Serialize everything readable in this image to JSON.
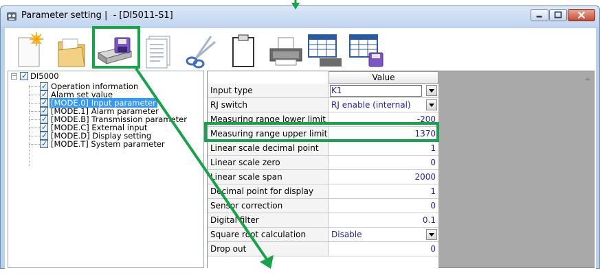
{
  "window": {
    "title": "Parameter setting |  - [DI5011-S1]"
  },
  "toolbar": {
    "tools": [
      {
        "name": "new-file-icon"
      },
      {
        "name": "open-folder-icon"
      },
      {
        "name": "save-to-device-icon"
      },
      {
        "name": "document-icon"
      },
      {
        "name": "scissors-icon"
      },
      {
        "name": "clipboard-icon"
      },
      {
        "name": "printer-icon"
      },
      {
        "name": "print-table-icon"
      },
      {
        "name": "save-table-icon"
      }
    ]
  },
  "tree": {
    "root": "DI5000",
    "items": [
      {
        "label": "Operation information",
        "selected": false
      },
      {
        "label": "Alarm set value",
        "selected": false
      },
      {
        "label": "[MODE.0] Input parameter",
        "selected": true
      },
      {
        "label": "[MODE.1] Alarm parameter",
        "selected": false
      },
      {
        "label": "[MODE.B] Transmission parameter",
        "selected": false
      },
      {
        "label": "[MODE.C] External input",
        "selected": false
      },
      {
        "label": "[MODE.D] Display setting",
        "selected": false
      },
      {
        "label": "[MODE.T] System parameter",
        "selected": false
      }
    ]
  },
  "grid": {
    "header": "Value",
    "rows": [
      {
        "name": "Input type",
        "value": "K1",
        "combo": true
      },
      {
        "name": "RJ switch",
        "value": "RJ enable (internal)",
        "combo": true
      },
      {
        "name": "Measuring range lower limit",
        "value": "-200",
        "combo": false
      },
      {
        "name": "Measuring range upper limit",
        "value": "1370",
        "combo": false
      },
      {
        "name": "Linear scale decimal point",
        "value": "1",
        "combo": false
      },
      {
        "name": "Linear scale zero",
        "value": "0",
        "combo": false
      },
      {
        "name": "Linear scale span",
        "value": "2000",
        "combo": false
      },
      {
        "name": "Decimal point for display",
        "value": "1",
        "combo": false
      },
      {
        "name": "Sensor correction",
        "value": "0",
        "combo": false
      },
      {
        "name": "Digital filter",
        "value": "0.1",
        "combo": false
      },
      {
        "name": "Square root calculation",
        "value": "Disable",
        "combo": true
      },
      {
        "name": "Drop out",
        "value": "0",
        "combo": false
      }
    ]
  },
  "colors": {
    "highlight": "#16a34a",
    "value_text": "#1f1fb4",
    "selection": "#3399ff"
  }
}
